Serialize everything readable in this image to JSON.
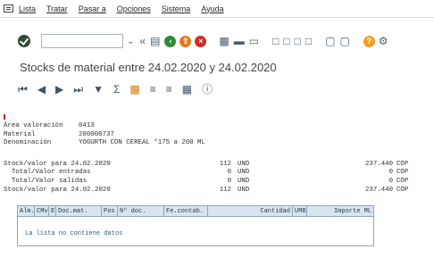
{
  "menubar": {
    "items": [
      "Lista",
      "Tratar",
      "Pasar a",
      "Opciones",
      "Sistema",
      "Ayuda"
    ]
  },
  "toolbar": {
    "icons": [
      "back-icon",
      "exit-icon",
      "cancel-icon",
      "print-icon",
      "find-icon",
      "find-next-icon",
      "first-page-icon",
      "previous-page-icon",
      "next-page-icon",
      "last-page-icon",
      "new-session-icon",
      "shortcut-icon",
      "help-icon",
      "customize-icon"
    ]
  },
  "title": "Stocks de material entre 24.02.2020 y 24.02.2020",
  "app_toolbar": {
    "icons": [
      "first-icon",
      "previous-icon",
      "next-icon",
      "last-icon",
      "filter-icon",
      "sum-icon",
      "export-icon",
      "sort-asc-icon",
      "sort-desc-icon",
      "layout-icon",
      "info-icon"
    ]
  },
  "header": {
    "rows": [
      {
        "label": "Área valoración",
        "value": "0413"
      },
      {
        "label": "Material",
        "value": "200000737"
      },
      {
        "label": "Denominación",
        "value": "YOGURTH CON CEREAL *175 a 200 ML"
      }
    ]
  },
  "stock_rows": [
    {
      "label": "Stock/valor para 24.02.2020",
      "qty": "112",
      "unit": "UND",
      "amount": "237.440",
      "currency": "COP"
    },
    {
      "label": "  Total/Valor entradas",
      "qty": "0",
      "unit": "UND",
      "amount": "0",
      "currency": "COP"
    },
    {
      "label": "  Total/Valor salidas",
      "qty": "0",
      "unit": "UND",
      "amount": "0",
      "currency": "COP"
    },
    {
      "label": "Stock/valor para 24.02.2020",
      "qty": "112",
      "unit": "UND",
      "amount": "237.440",
      "currency": "COP"
    }
  ],
  "table": {
    "columns": [
      "Alm.",
      "CMv",
      "E",
      "Doc.mat.",
      "Pos",
      "Nº doc.",
      "Fe.contab.",
      "Cantidad",
      "UMB",
      "Importe ML"
    ],
    "empty_message": "La lista no contiene datos"
  },
  "colors": {
    "table_header_bg": "#d8e4f0",
    "ok_button": "#2f4a2f",
    "empty_message": "#2e5a86"
  }
}
